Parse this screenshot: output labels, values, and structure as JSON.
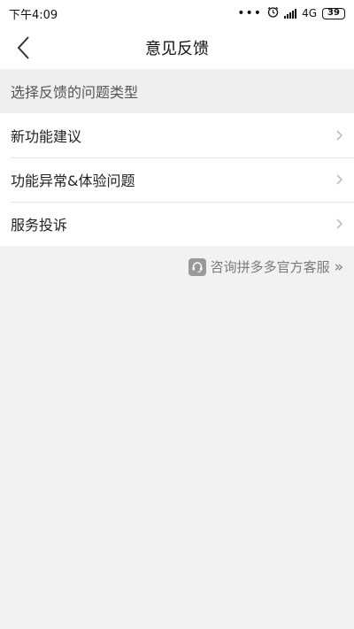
{
  "status_bar": {
    "time": "下午4:09",
    "dots": "•••",
    "network": "4G",
    "battery": "39"
  },
  "nav": {
    "title": "意见反馈"
  },
  "section": {
    "header": "选择反馈的问题类型"
  },
  "list": {
    "items": [
      {
        "label": "新功能建议"
      },
      {
        "label": "功能异常&体验问题"
      },
      {
        "label": "服务投诉"
      }
    ]
  },
  "service": {
    "label": "咨询拼多多官方客服",
    "arrow": "»"
  }
}
